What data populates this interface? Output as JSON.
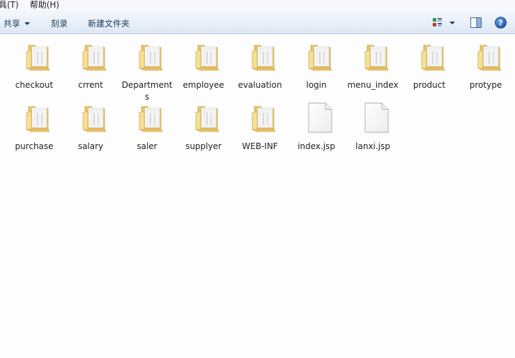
{
  "menubar": {
    "tools_label": "具(T)",
    "help_label": "帮助(H)"
  },
  "toolbar": {
    "share_label": "共享",
    "burn_label": "刻录",
    "new_folder_label": "新建文件夹"
  },
  "items": [
    {
      "name": "checkout",
      "type": "folder"
    },
    {
      "name": "crrent",
      "type": "folder"
    },
    {
      "name": "Departments",
      "type": "folder"
    },
    {
      "name": "employee",
      "type": "folder"
    },
    {
      "name": "evaluation",
      "type": "folder"
    },
    {
      "name": "login",
      "type": "folder"
    },
    {
      "name": "menu_index",
      "type": "folder"
    },
    {
      "name": "product",
      "type": "folder"
    },
    {
      "name": "protype",
      "type": "folder"
    },
    {
      "name": "purchase",
      "type": "folder"
    },
    {
      "name": "salary",
      "type": "folder"
    },
    {
      "name": "saler",
      "type": "folder"
    },
    {
      "name": "supplyer",
      "type": "folder"
    },
    {
      "name": "WEB-INF",
      "type": "folder"
    },
    {
      "name": "index.jsp",
      "type": "file"
    },
    {
      "name": "lanxi.jsp",
      "type": "file"
    }
  ],
  "colors": {
    "toolbar_text": "#1e395b",
    "folder_yellow": "#f3d98a",
    "window_bg": "#fdfdfd"
  }
}
